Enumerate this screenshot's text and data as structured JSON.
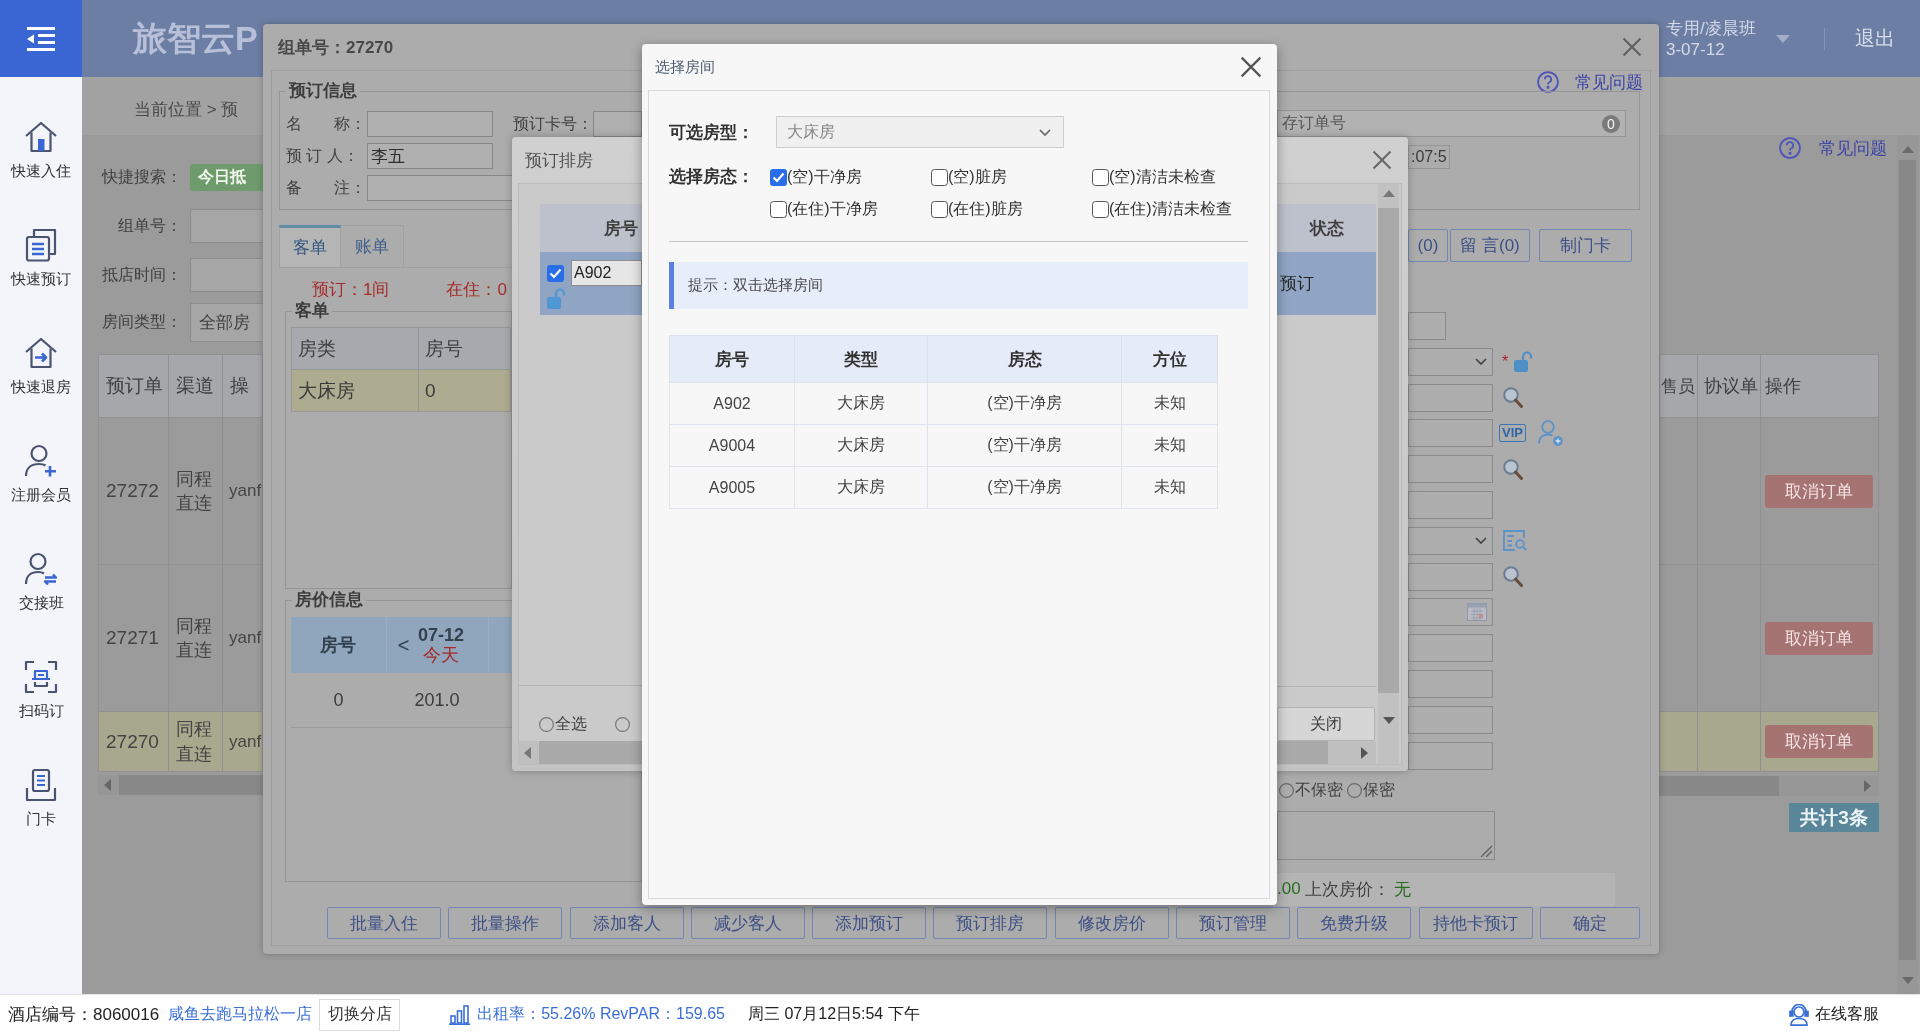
{
  "header": {
    "title": "旅智云P",
    "shift": "专用/凌晨班",
    "date": "3-07-12",
    "logout": "退出"
  },
  "sidebar": {
    "items": [
      "快速入住",
      "快速预订",
      "快速退房",
      "注册会员",
      "交接班",
      "扫码订",
      "门卡"
    ]
  },
  "breadcrumb": "当前位置 > 预",
  "help_link": "常见问题",
  "quick_search": {
    "label": "快捷搜索：",
    "button": "今日抵"
  },
  "filters": [
    {
      "label": "组单号：",
      "kind": "input"
    },
    {
      "label": "抵店时间：",
      "kind": "input"
    },
    {
      "label": "房间类型：",
      "kind": "select",
      "value": "全部房"
    }
  ],
  "orders": {
    "columns": [
      "预订单",
      "渠道",
      "操"
    ],
    "columns_right": [
      "售员",
      "协议单",
      "操作"
    ],
    "rows": [
      {
        "id": "27272",
        "channel": "同程直连",
        "operator": "yanf",
        "action": "取消订单",
        "selected": false
      },
      {
        "id": "27271",
        "channel": "同程直连",
        "operator": "yanf",
        "action": "取消订单",
        "selected": false
      },
      {
        "id": "27270",
        "channel": "同程直连",
        "operator": "yanf",
        "action": "取消订单",
        "selected": true
      }
    ],
    "total": "共计3条"
  },
  "order_dialog": {
    "title": "组单号：27270",
    "help_link": "常见问题",
    "booking": {
      "legend": "预订信息",
      "fields": [
        {
          "label": "名　　称："
        },
        {
          "label": "预订卡号："
        },
        {
          "label": "预 订 人：",
          "value": "李五"
        },
        {
          "label": "备　　注："
        }
      ],
      "order_no": {
        "placeholder": "存订单号",
        "badge": "0"
      },
      "time_value": ":07:5"
    },
    "side_buttons": [
      "(0)",
      "留 言(0)",
      "制门卡"
    ],
    "tabs": [
      {
        "label": "客单",
        "selected": true
      },
      {
        "label": "账单",
        "selected": false
      }
    ],
    "counts": [
      "预订：1间",
      "在住：0"
    ],
    "guest_list": {
      "legend": "客单",
      "columns": [
        "房类",
        "房号"
      ],
      "rows": [
        {
          "cells": [
            "大床房",
            "0"
          ],
          "selected": true
        }
      ]
    },
    "rates": {
      "legend": "房价信息",
      "room_column": "房号",
      "prev": "<",
      "date": "07-12",
      "day": "今天",
      "rows": [
        {
          "room": "0",
          "price": "201.0"
        }
      ]
    },
    "form_fields": [
      {
        "kind": "short"
      },
      {
        "kind": "select",
        "mark": "*",
        "locked": false
      },
      {
        "kind": "lookup"
      },
      {
        "kind": "member",
        "badge": "VIP"
      },
      {
        "kind": "lookup"
      },
      {
        "kind": "text"
      },
      {
        "kind": "browse"
      },
      {
        "kind": "lookup"
      },
      {
        "kind": "date"
      },
      {
        "kind": "text"
      },
      {
        "kind": "text"
      },
      {
        "kind": "text"
      },
      {
        "kind": "text"
      }
    ],
    "privacy": [
      {
        "label": "不保密",
        "selected": false
      },
      {
        "label": "保密",
        "selected": false
      }
    ],
    "price_line": {
      "amount": ".00",
      "label": "上次房价：",
      "value": "无"
    },
    "buttons": [
      "批量入住",
      "批量操作",
      "添加客人",
      "减少客人",
      "添加预订",
      "预订排房",
      "修改房价",
      "预订管理",
      "免费升级",
      "持他卡预订",
      "确定"
    ]
  },
  "arrange_dialog": {
    "title": "预订排房",
    "columns": [
      "房号",
      "状态"
    ],
    "rows": [
      {
        "room": "A902",
        "status": "预订",
        "checked": true,
        "selected": true,
        "locked": false
      }
    ],
    "radios": [
      {
        "label": "全选",
        "selected": false
      },
      {
        "selected": false
      }
    ],
    "close_button": "关闭"
  },
  "room_dialog": {
    "title": "选择房间",
    "type_label": "可选房型：",
    "type_value": "大床房",
    "status_label": "选择房态：",
    "statuses": [
      {
        "label": "(空)干净房",
        "checked": true
      },
      {
        "label": "(空)脏房",
        "checked": false
      },
      {
        "label": "(空)清洁未检查",
        "checked": false
      },
      {
        "label": "(在住)干净房",
        "checked": false
      },
      {
        "label": "(在住)脏房",
        "checked": false
      },
      {
        "label": "(在住)清洁未检查",
        "checked": false
      }
    ],
    "hint": "提示：双击选择房间",
    "columns": [
      "房号",
      "类型",
      "房态",
      "方位"
    ],
    "rows": [
      {
        "cells": [
          "A902",
          "大床房",
          "(空)干净房",
          "未知"
        ],
        "selected": false
      },
      {
        "cells": [
          "A9004",
          "大床房",
          "(空)干净房",
          "未知"
        ],
        "selected": false
      },
      {
        "cells": [
          "A9005",
          "大床房",
          "(空)干净房",
          "未知"
        ],
        "selected": false
      }
    ]
  },
  "status_bar": {
    "hotel_label": "酒店编号：8060016",
    "hotel_name": "咸鱼去跑马拉松一店",
    "switch_button": "切换分店",
    "occupancy": "出租率：55.26% RevPAR：159.65",
    "datetime": "周三 07月12日5:54 下午",
    "support": "在线客服"
  }
}
